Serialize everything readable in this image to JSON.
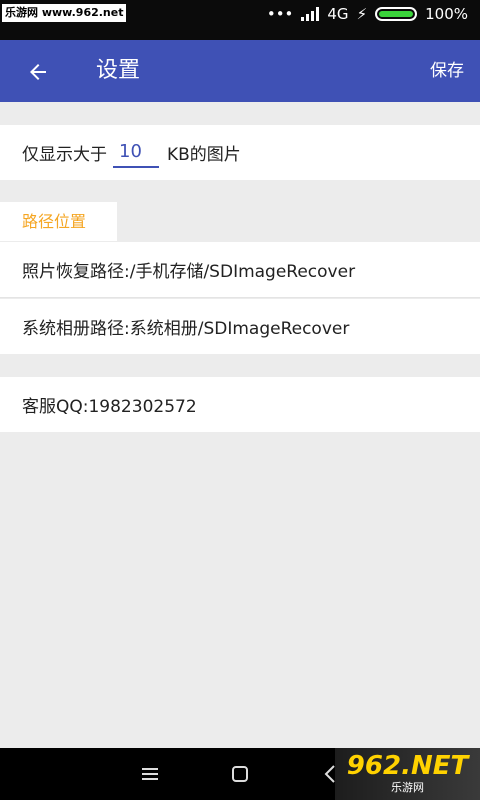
{
  "status_bar": {
    "watermark_text": "乐游网 www.962.net",
    "network": "4G",
    "battery": "100%"
  },
  "app_bar": {
    "title": "设置",
    "save_label": "保存"
  },
  "size_filter": {
    "prefix": "仅显示大于",
    "value": "10",
    "suffix": "KB的图片"
  },
  "paths": {
    "section_label": "路径位置",
    "photo_recover_path": "照片恢复路径:/手机存储/SDImageRecover",
    "album_path": "系统相册路径:系统相册/SDImageRecover"
  },
  "support": {
    "qq": "客服QQ:1982302572"
  },
  "nav_watermark": {
    "big": "962.NET",
    "small": "乐游网"
  },
  "colors": {
    "primary": "#3f51b5",
    "accent": "#f5a623"
  }
}
